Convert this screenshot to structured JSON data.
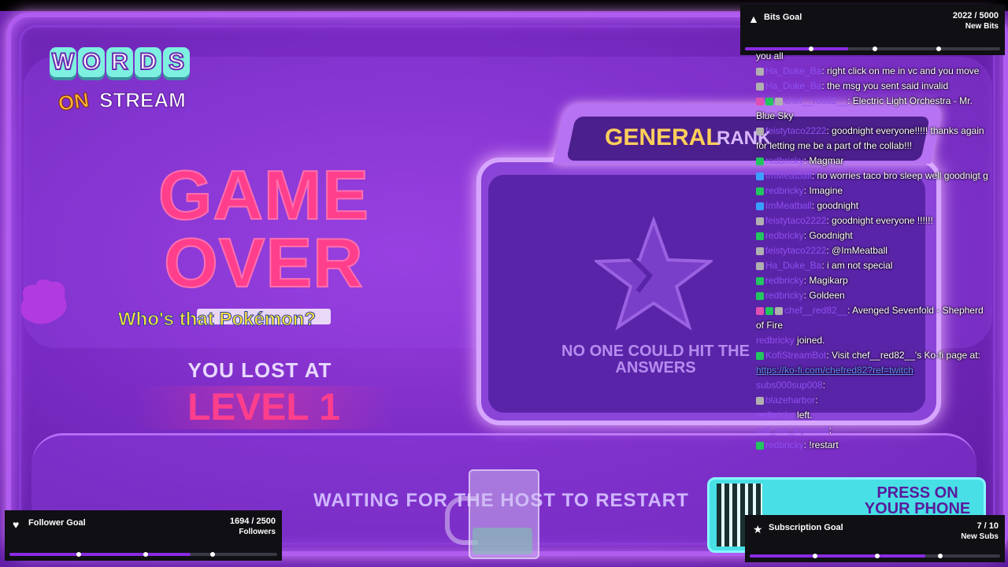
{
  "game": {
    "logo_top": [
      "W",
      "O",
      "R",
      "D",
      "S"
    ],
    "logo_on": "ON",
    "logo_stream": "STREAM",
    "game_over": "GAME OVER",
    "pokemon_prompt": "Who's that Pokémon?",
    "you_lost_at": "YOU LOST AT",
    "level": "LEVEL 1",
    "tab_general": "GENERAL",
    "tab_rank": "RANK",
    "no_one_hit": "NO ONE COULD HIT THE ANSWERS",
    "waiting": "WAITING FOR THE HOST TO RESTART",
    "press_qr": "PRESS ON YOUR PHONE INSTEAD"
  },
  "goals": {
    "bits": {
      "title": "Bits Goal",
      "count": "2022 / 5000",
      "unit": "New Bits",
      "progress": 0.4044
    },
    "follower": {
      "title": "Follower Goal",
      "count": "1694 / 2500",
      "unit": "Followers",
      "progress": 0.6776
    },
    "subscription": {
      "title": "Subscription Goal",
      "count": "7 / 10",
      "unit": "New Subs",
      "progress": 0.7
    }
  },
  "chat": [
    {
      "badges": [],
      "user": "",
      "text": "you all"
    },
    {
      "badges": [
        "sub"
      ],
      "user": "Ha_Duke_Ba",
      "text": ": right click on me in vc and you move"
    },
    {
      "badges": [
        "sub"
      ],
      "user": "Ha_Duke_Ba",
      "text": ": the msg you sent said invalid"
    },
    {
      "badges": [
        "mod",
        "check",
        "sub"
      ],
      "user": "chef__red82__",
      "text": ": Electric Light Orchestra - Mr. Blue Sky"
    },
    {
      "badges": [
        "sub"
      ],
      "user": "feistytaco2222",
      "text": ": goodnight everyone!!!!! thanks again for letting me be a part of the collab!!!"
    },
    {
      "badges": [
        "check"
      ],
      "user": "redbricky",
      "text": ": Magmar"
    },
    {
      "badges": [
        "crown"
      ],
      "user": "ImMeatball",
      "text": ": no worries taco bro sleep well goodnigt g"
    },
    {
      "badges": [
        "check"
      ],
      "user": "redbricky",
      "text": ": Imagine"
    },
    {
      "badges": [
        "crown"
      ],
      "user": "ImMeatball",
      "text": ": goodnight"
    },
    {
      "badges": [
        "sub"
      ],
      "user": "feistytaco2222",
      "text": ": goodnight everyone !!!!!!"
    },
    {
      "badges": [
        "check"
      ],
      "user": "redbricky",
      "text": ": Goodnight"
    },
    {
      "badges": [
        "sub"
      ],
      "user": "feistytaco2222",
      "text": ": @ImMeatball"
    },
    {
      "badges": [
        "sub"
      ],
      "user": "Ha_Duke_Ba",
      "text": ": i am not special"
    },
    {
      "badges": [
        "check"
      ],
      "user": "redbricky",
      "text": ": Magikarp"
    },
    {
      "badges": [
        "check"
      ],
      "user": "redbricky",
      "text": ": Goldeen"
    },
    {
      "badges": [
        "mod",
        "check",
        "sub"
      ],
      "user": "chef__red82__",
      "text": ": Avenged Sevenfold - Shepherd of Fire"
    },
    {
      "badges": [],
      "user": "redbricky",
      "text": " joined."
    },
    {
      "badges": [
        "check"
      ],
      "user": "KofiStreamBot",
      "text": ": Visit chef__red82__'s Ko-fi page at: ",
      "link": "https://ko-fi.com/chefred82?ref=twitch"
    },
    {
      "badges": [],
      "user": "subs000sup008",
      "text": ":"
    },
    {
      "badges": [
        "sub"
      ],
      "user": "blazeharbor",
      "text": ":"
    },
    {
      "badges": [],
      "user": "redbricky",
      "text": " left."
    },
    {
      "badges": [],
      "user": "call_me_lojomadl",
      "text": ":"
    },
    {
      "badges": [
        "check"
      ],
      "user": "redbricky",
      "text": ": !restart"
    }
  ]
}
